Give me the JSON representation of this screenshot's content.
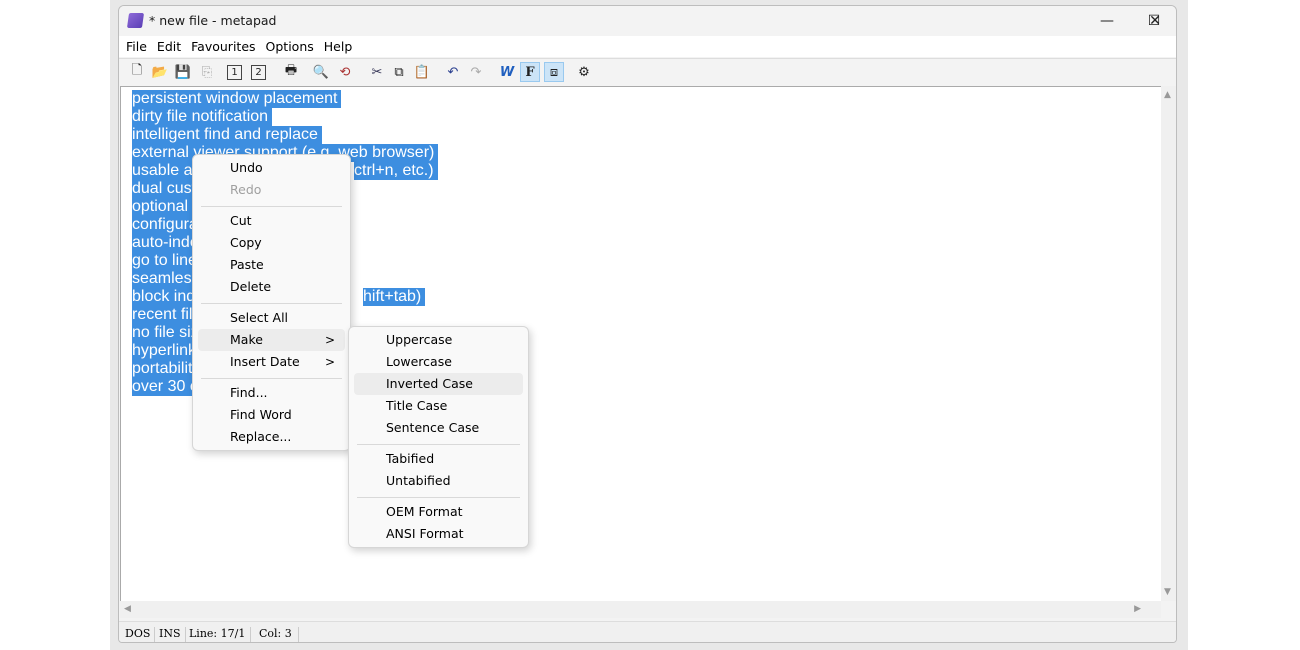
{
  "window": {
    "title": "* new file - metapad",
    "minimize": "—",
    "maximize": "☐",
    "close": "✕"
  },
  "menubar": [
    "File",
    "Edit",
    "Favourites",
    "Options",
    "Help"
  ],
  "toolbar": [
    {
      "icon": "new-file-icon",
      "glyph": "🗋"
    },
    {
      "icon": "open-folder-icon",
      "glyph": "📂"
    },
    {
      "icon": "save-icon",
      "glyph": "💾"
    },
    {
      "icon": "launch-viewer-icon",
      "glyph": "⎘"
    },
    {
      "icon": "primary-viewer-icon",
      "glyph": "1"
    },
    {
      "icon": "secondary-viewer-icon",
      "glyph": "2"
    },
    {
      "icon": "print-icon",
      "glyph": "🖶"
    },
    {
      "icon": "find-icon",
      "glyph": "🔍"
    },
    {
      "icon": "replace-icon",
      "glyph": "⟲"
    },
    {
      "icon": "cut-icon",
      "glyph": "✂"
    },
    {
      "icon": "copy-icon",
      "glyph": "⧉"
    },
    {
      "icon": "paste-icon",
      "glyph": "📋"
    },
    {
      "icon": "undo-icon",
      "glyph": "↶"
    },
    {
      "icon": "redo-icon",
      "glyph": "↷"
    },
    {
      "icon": "word-wrap-icon",
      "glyph": "W"
    },
    {
      "icon": "font-icon",
      "glyph": "F"
    },
    {
      "icon": "always-on-top-icon",
      "glyph": "⧈"
    },
    {
      "icon": "settings-icon",
      "glyph": "⚙"
    }
  ],
  "editor": {
    "selection_color": "#3d8ee0",
    "lines": [
      {
        "left": "persistent window placement"
      },
      {
        "left": "dirty file notification"
      },
      {
        "left": "intelligent find and replace"
      },
      {
        "left": "external viewer support (e.g. web browser)"
      },
      {
        "left": "usable a",
        "right": "ctrl+n, etc.)"
      },
      {
        "left": "dual cust"
      },
      {
        "left": "optional c"
      },
      {
        "left": "configura"
      },
      {
        "left": "auto-inde"
      },
      {
        "left": "go to line"
      },
      {
        "left": "seamless"
      },
      {
        "left": "block ind",
        "right": "hift+tab)"
      },
      {
        "left": "recent file"
      },
      {
        "left": "no file siz"
      },
      {
        "left": "hyperlink"
      },
      {
        "left": "portabilit"
      },
      {
        "left": "over 30 c"
      }
    ]
  },
  "context_menu": {
    "items": [
      "Undo",
      "Redo",
      "Cut",
      "Copy",
      "Paste",
      "Delete",
      "Select All",
      "Make",
      "Insert Date",
      "Find...",
      "Find Word",
      "Replace..."
    ],
    "submenu_arrow": ">"
  },
  "make_submenu": {
    "items": [
      "Uppercase",
      "Lowercase",
      "Inverted Case",
      "Title Case",
      "Sentence Case",
      "Tabified",
      "Untabified",
      "OEM Format",
      "ANSI Format"
    ]
  },
  "status": {
    "mode": "DOS",
    "insert": "INS",
    "line": "Line: 17/1",
    "col": "Col: 3"
  }
}
